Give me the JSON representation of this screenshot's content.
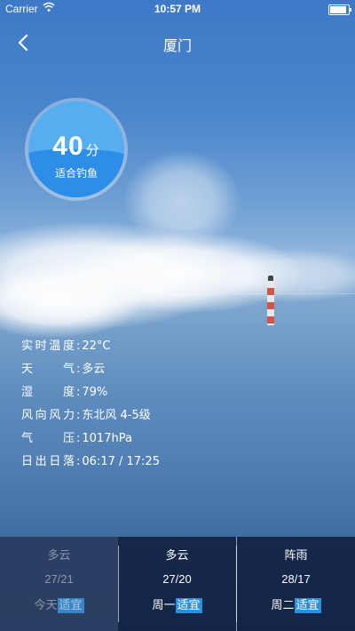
{
  "status_bar": {
    "carrier": "Carrier",
    "time": "10:57 PM",
    "battery_level": 1.0
  },
  "nav": {
    "title": "厦门"
  },
  "score": {
    "value": "40",
    "unit": "分",
    "description": "适合钓鱼"
  },
  "details": [
    {
      "label": "实时温度",
      "value": "22°C"
    },
    {
      "label": "天气",
      "value": "多云"
    },
    {
      "label": "湿度",
      "value": "79%"
    },
    {
      "label": "风向风力",
      "value": "东北风 4-5级"
    },
    {
      "label": "气压",
      "value": "1017hPa"
    },
    {
      "label": "日出日落",
      "value": "06:17 / 17:25"
    }
  ],
  "detail_separator": ":",
  "forecast": [
    {
      "condition": "多云",
      "temp": "27/21",
      "day": "今天",
      "suitability": "适宜"
    },
    {
      "condition": "多云",
      "temp": "27/20",
      "day": "周一",
      "suitability": "适宜"
    },
    {
      "condition": "阵雨",
      "temp": "28/17",
      "day": "周二",
      "suitability": "适宜"
    }
  ],
  "colors": {
    "badge": "#2b8fe0",
    "score_fill": "#2d8ee8",
    "forecast_bg": "#112242"
  }
}
